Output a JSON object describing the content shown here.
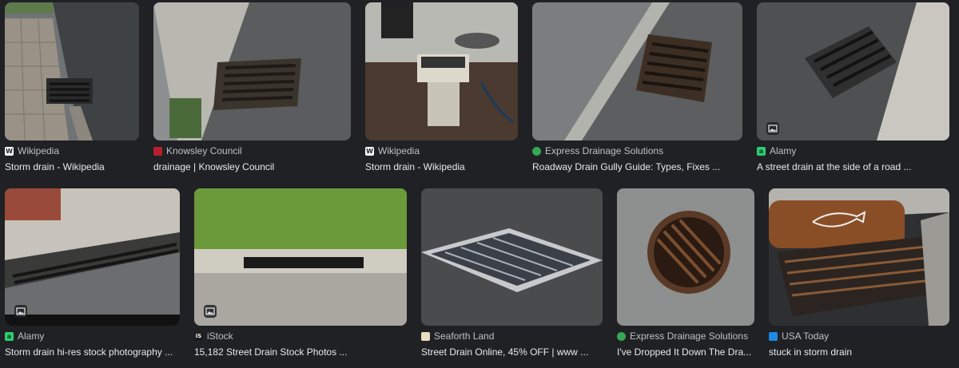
{
  "results": [
    {
      "source": "Wikipedia",
      "title": "Storm drain - Wikipedia",
      "favicon": "wikipedia-icon",
      "favicon_char": "W",
      "favicon_bg": "#ffffff",
      "favicon_fg": "#202124"
    },
    {
      "source": "Knowsley Council",
      "title": "drainage | Knowsley Council",
      "favicon": "knowsley-council-icon",
      "favicon_char": "",
      "favicon_bg": "#b7202e",
      "favicon_fg": "#ffffff"
    },
    {
      "source": "Wikipedia",
      "title": "Storm drain - Wikipedia",
      "favicon": "wikipedia-icon",
      "favicon_char": "W",
      "favicon_bg": "#ffffff",
      "favicon_fg": "#202124"
    },
    {
      "source": "Express Drainage Solutions",
      "title": "Roadway Drain Gully Guide: Types, Fixes ...",
      "favicon": "express-drainage-icon",
      "favicon_char": "",
      "favicon_bg": "#34a853",
      "favicon_fg": "#ffffff"
    },
    {
      "source": "Alamy",
      "title": "A street drain at the side of a road ...",
      "favicon": "alamy-icon",
      "favicon_char": "a",
      "favicon_bg": "#2ecc71",
      "favicon_fg": "#0b3d1f"
    },
    {
      "source": "Alamy",
      "title": "Storm drain hi-res stock photography ...",
      "favicon": "alamy-icon",
      "favicon_char": "a",
      "favicon_bg": "#2ecc71",
      "favicon_fg": "#0b3d1f"
    },
    {
      "source": "iStock",
      "title": "15,182 Street Drain Stock Photos ...",
      "favicon": "istock-icon",
      "favicon_char": "iS",
      "favicon_bg": "#1b1b1b",
      "favicon_fg": "#ffffff"
    },
    {
      "source": "Seaforth Land",
      "title": "Street Drain Online, 45% OFF | www ...",
      "favicon": "seaforth-land-icon",
      "favicon_char": "",
      "favicon_bg": "#e9dcc0",
      "favicon_fg": "#5b4a2c"
    },
    {
      "source": "Express Drainage Solutions",
      "title": "I've Dropped It Down The Dra...",
      "favicon": "express-drainage-icon",
      "favicon_char": "",
      "favicon_bg": "#34a853",
      "favicon_fg": "#ffffff"
    },
    {
      "source": "USA Today",
      "title": "stuck in storm drain",
      "favicon": "usa-today-icon",
      "favicon_char": "",
      "favicon_bg": "#1e88e5",
      "favicon_fg": "#ffffff"
    }
  ],
  "thumbnail_badge_icon": "image-icon",
  "colors": {
    "background": "#202124",
    "source_text": "#bdc1c6",
    "title_text": "#e8eaed"
  }
}
